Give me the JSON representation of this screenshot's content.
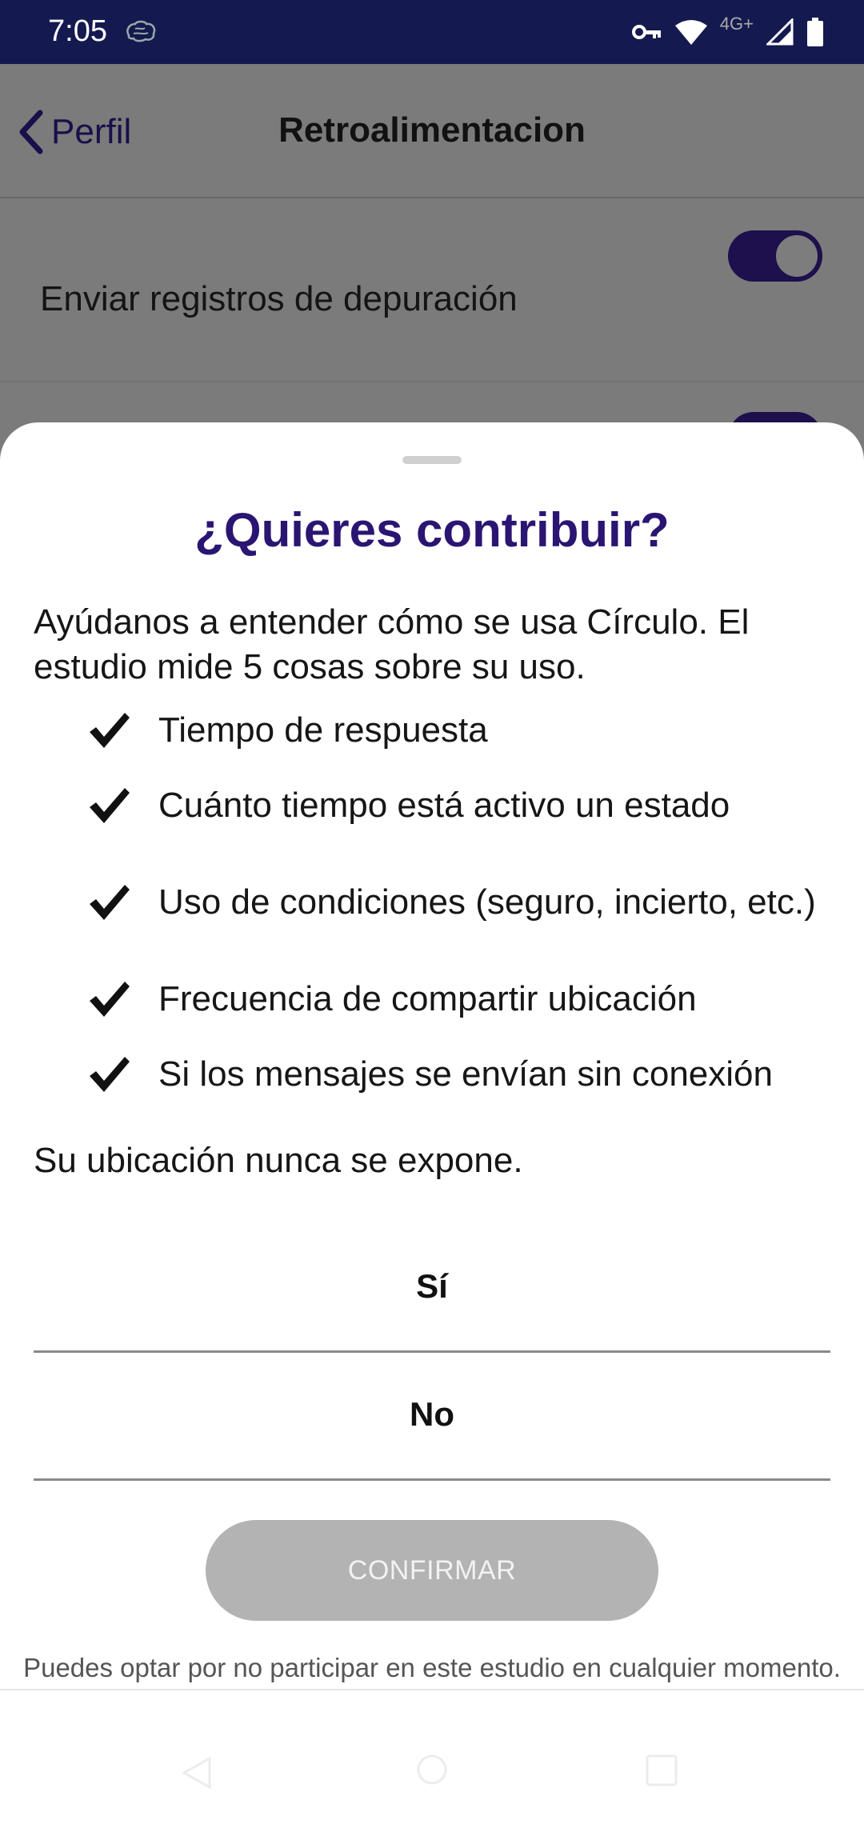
{
  "status_bar": {
    "time": "7:05",
    "network_label": "4G+",
    "icons": [
      "brain-icon",
      "vpn-key-icon",
      "wifi-icon",
      "signal-icon",
      "battery-icon"
    ]
  },
  "background_page": {
    "back_label": "Perfil",
    "title": "Retroalimentacion",
    "setting_label": "Enviar registros de depuración",
    "setting_enabled": true
  },
  "sheet": {
    "title": "¿Quieres contribuir?",
    "intro": "Ayúdanos a entender cómo se usa Círculo. El estudio mide 5 cosas sobre su uso.",
    "items": [
      "Tiempo de respuesta",
      "Cuánto tiempo está activo un estado",
      "Uso de condiciones (seguro, incierto, etc.)",
      "Frecuencia de compartir ubicación",
      "Si los mensajes se envían sin conexión"
    ],
    "disclaimer": "Su ubicación nunca se expone.",
    "option_yes": "Sí",
    "option_no": "No",
    "confirm_label": "CONFIRMAR",
    "footnote": "Puedes optar por no participar en este estudio en cualquier momento."
  },
  "colors": {
    "status_bar": "#141a4f",
    "title": "#2b1572",
    "toggle": "#1e0f4d",
    "confirm_disabled": "#b3b3b3"
  }
}
